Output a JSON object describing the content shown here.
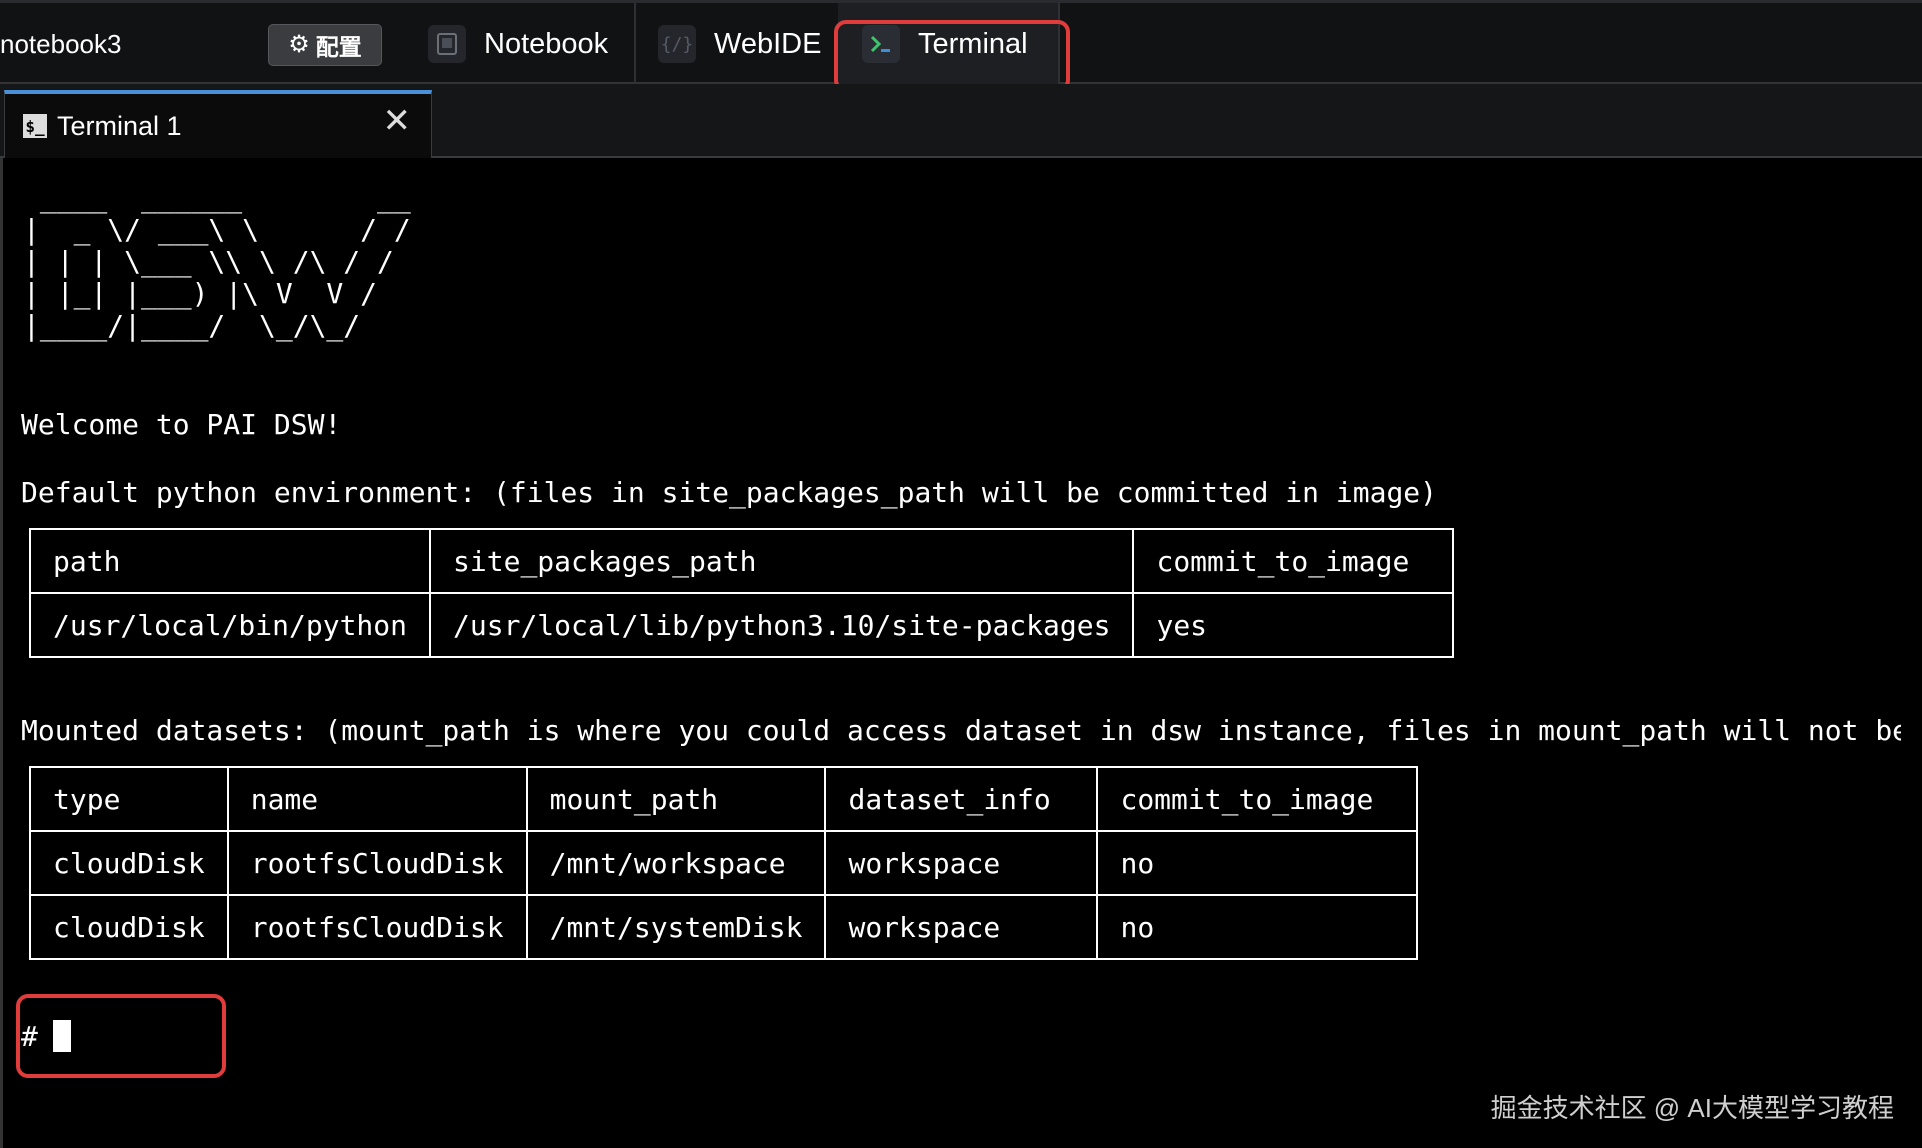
{
  "topbar": {
    "notebook_name": "notebook3",
    "config_label": "配置",
    "tabs": [
      {
        "label": "Notebook",
        "icon": "notebook-icon"
      },
      {
        "label": "WebIDE",
        "icon": "code-icon"
      },
      {
        "label": "Terminal",
        "icon": "terminal-icon"
      }
    ]
  },
  "terminal_tab": {
    "label": "Terminal 1",
    "close": "✕"
  },
  "terminal": {
    "ascii_art": " ____  ______        __\n|  _ \\/ ___\\ \\      / /\n| | | \\___ \\\\ \\ /\\ / /\n| |_| |___) |\\ V  V /\n|____/|____/  \\_/\\_/",
    "welcome": "Welcome to PAI DSW!",
    "default_env": "Default python environment: (files in site_packages_path will be committed in image)",
    "env_table": {
      "headers": [
        "path",
        "site_packages_path",
        "commit_to_image"
      ],
      "rows": [
        [
          "/usr/local/bin/python",
          "/usr/local/lib/python3.10/site-packages",
          "yes"
        ]
      ]
    },
    "mounted": "Mounted datasets: (mount_path is where you could access dataset in dsw instance, files in mount_path will not be commit",
    "datasets_table": {
      "headers": [
        "type",
        "name",
        "mount_path",
        "dataset_info",
        "commit_to_image"
      ],
      "rows": [
        [
          "cloudDisk",
          "rootfsCloudDisk",
          "/mnt/workspace",
          "workspace",
          "no"
        ],
        [
          "cloudDisk",
          "rootfsCloudDisk",
          "/mnt/systemDisk",
          "workspace",
          "no"
        ]
      ]
    },
    "prompt": "#"
  },
  "watermark": "掘金技术社区 @ AI大模型学习教程",
  "colors": {
    "highlight": "#e03c3c",
    "active_tab": "#4a90d9",
    "prompt_green": "#3ec46d"
  }
}
